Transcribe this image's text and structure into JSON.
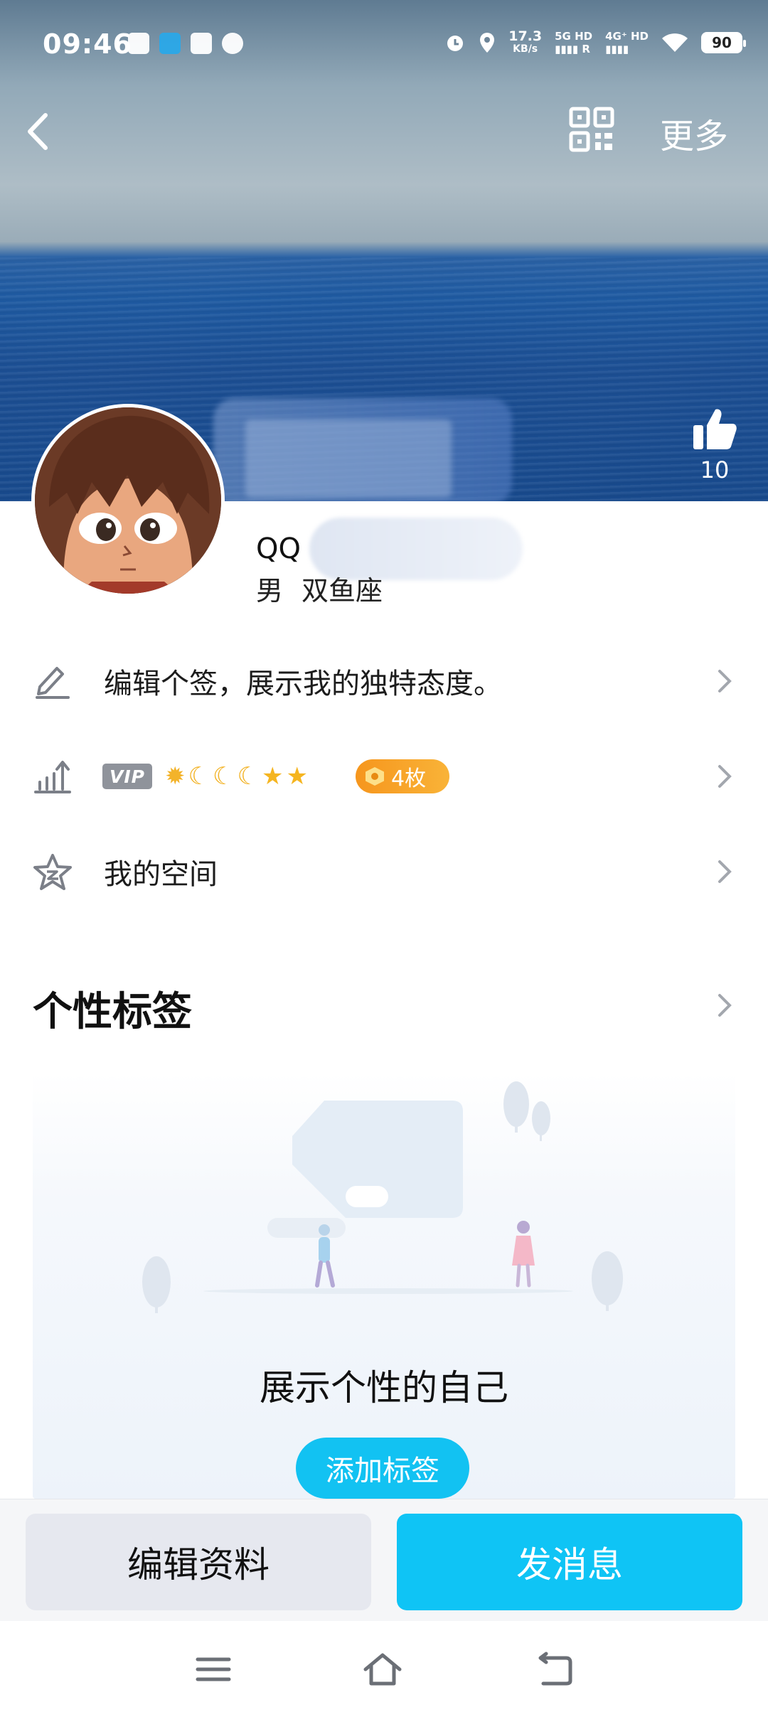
{
  "status_bar": {
    "time": "09:46",
    "net_speed_value": "17.3",
    "net_speed_unit": "KB/s",
    "sim1": "5G HD",
    "sim1_sub": "R",
    "sim2": "4G⁺ HD",
    "battery": "90"
  },
  "nav": {
    "more_label": "更多"
  },
  "profile": {
    "likes": "10",
    "name_prefix": "QQ",
    "gender": "男",
    "zodiac": "双鱼座"
  },
  "rows": {
    "signature": "编辑个签，展示我的独特态度。",
    "vip_tag": "VIP",
    "badge_count": "4枚",
    "space": "我的空间"
  },
  "tags_section": {
    "title": "个性标签",
    "caption": "展示个性的自己",
    "add_button": "添加标签"
  },
  "actions": {
    "edit_profile": "编辑资料",
    "send_message": "发消息"
  },
  "colors": {
    "accent": "#0fc4f5",
    "badge_orange": "#f6961d",
    "vip_gray": "#8f939b"
  }
}
